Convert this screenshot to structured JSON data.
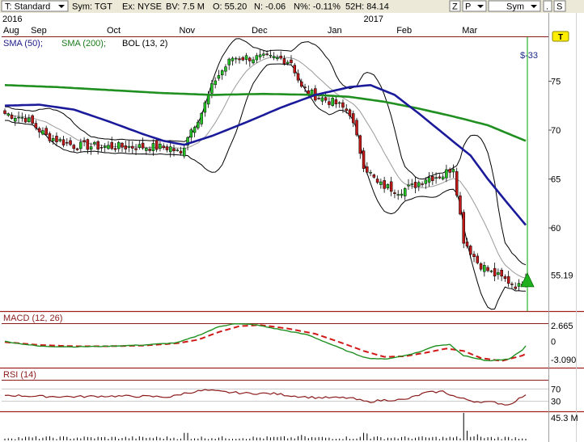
{
  "toolbar": {
    "template": "T: Standard",
    "symbol": "Sym: TGT",
    "exchange": "Ex: NYSE",
    "bid_volume": "BV: 7.5 M",
    "open": "O: 55.20",
    "net_change": "N: -0.06",
    "net_pct": "N%: -0.11%",
    "high52": "52H: 84.14",
    "btn_z": "Z",
    "btn_p": "P",
    "btn_sym": "Sym",
    "btn_dot": ".",
    "btn_s": "S"
  },
  "timeline": {
    "year_labels": [
      {
        "label": "2016",
        "index": 0
      },
      {
        "label": "2017",
        "index": 104
      }
    ],
    "month_labels": [
      {
        "label": "Aug",
        "index": 0
      },
      {
        "label": "Sep",
        "index": 8
      },
      {
        "label": "Oct",
        "index": 30
      },
      {
        "label": "Nov",
        "index": 51
      },
      {
        "label": "Dec",
        "index": 72
      },
      {
        "label": "Jan",
        "index": 94
      },
      {
        "label": "Feb",
        "index": 114
      },
      {
        "label": "Mar",
        "index": 133
      }
    ]
  },
  "chart_data": {
    "type": "candlestick",
    "symbol": "TGT",
    "bars": 152,
    "price_axis": {
      "ticks": [
        75,
        70,
        65,
        60
      ],
      "last_price": "55.19",
      "ylim": [
        51.5,
        79.5
      ]
    },
    "legend": {
      "sma50": "SMA (50);",
      "sma200": "SMA (200);",
      "bol": "BOL (13, 2)"
    },
    "signal": {
      "label": "$-33",
      "badge": "T"
    },
    "price_anchors": [
      [
        0,
        71.7
      ],
      [
        6,
        71.2
      ],
      [
        12,
        69.4
      ],
      [
        20,
        68.4
      ],
      [
        30,
        68.3
      ],
      [
        40,
        68.3
      ],
      [
        48,
        68.2
      ],
      [
        51,
        67.5
      ],
      [
        53,
        69.5
      ],
      [
        57,
        71.8
      ],
      [
        61,
        75.2
      ],
      [
        66,
        77.4
      ],
      [
        72,
        77.4
      ],
      [
        80,
        77.3
      ],
      [
        83,
        77.0
      ],
      [
        86,
        74.3
      ],
      [
        90,
        73.5
      ],
      [
        96,
        72.7
      ],
      [
        100,
        71.8
      ],
      [
        104,
        66.5
      ],
      [
        108,
        64.5
      ],
      [
        114,
        63.8
      ],
      [
        118,
        64.2
      ],
      [
        122,
        65.1
      ],
      [
        127,
        65.4
      ],
      [
        130,
        66.3
      ],
      [
        133,
        58.8
      ],
      [
        137,
        56.5
      ],
      [
        141,
        55.4
      ],
      [
        145,
        54.7
      ],
      [
        149,
        54.0
      ],
      [
        151,
        55.2
      ]
    ],
    "sma50_anchors": [
      [
        0,
        72.5
      ],
      [
        10,
        72.6
      ],
      [
        20,
        72.1
      ],
      [
        30,
        70.9
      ],
      [
        40,
        69.6
      ],
      [
        46,
        68.9
      ],
      [
        52,
        68.5
      ],
      [
        60,
        69.4
      ],
      [
        70,
        70.8
      ],
      [
        80,
        72.3
      ],
      [
        90,
        73.6
      ],
      [
        100,
        74.4
      ],
      [
        106,
        74.6
      ],
      [
        113,
        73.6
      ],
      [
        120,
        71.7
      ],
      [
        128,
        69.4
      ],
      [
        135,
        67.4
      ],
      [
        140,
        65.0
      ],
      [
        146,
        62.4
      ],
      [
        151,
        60.3
      ]
    ],
    "sma200_anchors": [
      [
        0,
        74.6
      ],
      [
        15,
        74.4
      ],
      [
        30,
        74.1
      ],
      [
        45,
        73.8
      ],
      [
        60,
        73.6
      ],
      [
        75,
        73.7
      ],
      [
        90,
        73.6
      ],
      [
        100,
        73.4
      ],
      [
        110,
        72.9
      ],
      [
        120,
        72.2
      ],
      [
        130,
        71.4
      ],
      [
        140,
        70.5
      ],
      [
        151,
        68.9
      ]
    ],
    "macd": {
      "label": "MACD (12, 26)",
      "ticks": [
        {
          "label": "2.665",
          "value": 2.665
        },
        {
          "label": "0",
          "value": 0
        },
        {
          "label": "-3.090",
          "value": -3.09
        }
      ],
      "ylim": [
        -4.3,
        3.1
      ],
      "macd_anchors": [
        [
          0,
          0
        ],
        [
          10,
          -0.8
        ],
        [
          20,
          -0.9
        ],
        [
          30,
          -0.8
        ],
        [
          40,
          -0.6
        ],
        [
          50,
          -0.2
        ],
        [
          56,
          1.0
        ],
        [
          62,
          2.5
        ],
        [
          66,
          3.0
        ],
        [
          72,
          2.9
        ],
        [
          80,
          2.0
        ],
        [
          88,
          1.1
        ],
        [
          95,
          -0.6
        ],
        [
          100,
          -1.8
        ],
        [
          105,
          -2.8
        ],
        [
          110,
          -3.0
        ],
        [
          115,
          -2.5
        ],
        [
          120,
          -1.8
        ],
        [
          125,
          -0.7
        ],
        [
          129,
          -0.5
        ],
        [
          133,
          -2.4
        ],
        [
          140,
          -3.3
        ],
        [
          146,
          -3.0
        ],
        [
          150,
          -1.5
        ],
        [
          151,
          -0.8
        ]
      ],
      "signal_anchors": [
        [
          0,
          -0.1
        ],
        [
          10,
          -0.6
        ],
        [
          20,
          -0.8
        ],
        [
          30,
          -0.8
        ],
        [
          40,
          -0.7
        ],
        [
          50,
          -0.3
        ],
        [
          56,
          0.3
        ],
        [
          62,
          1.6
        ],
        [
          68,
          2.6
        ],
        [
          74,
          2.8
        ],
        [
          82,
          2.2
        ],
        [
          90,
          1.3
        ],
        [
          98,
          -0.3
        ],
        [
          104,
          -1.6
        ],
        [
          110,
          -2.6
        ],
        [
          116,
          -2.5
        ],
        [
          122,
          -1.9
        ],
        [
          128,
          -1.2
        ],
        [
          133,
          -1.6
        ],
        [
          138,
          -2.8
        ],
        [
          144,
          -3.3
        ],
        [
          150,
          -2.4
        ],
        [
          151,
          -2.1
        ]
      ]
    },
    "rsi": {
      "label": "RSI (14)",
      "ticks": [
        {
          "label": "70",
          "value": 70
        },
        {
          "label": "30",
          "value": 30
        }
      ],
      "ylim": [
        0,
        100
      ],
      "anchors": [
        [
          0,
          50
        ],
        [
          10,
          46
        ],
        [
          20,
          45
        ],
        [
          30,
          47
        ],
        [
          40,
          46
        ],
        [
          48,
          44
        ],
        [
          52,
          56
        ],
        [
          58,
          66
        ],
        [
          64,
          60
        ],
        [
          70,
          56
        ],
        [
          78,
          55
        ],
        [
          84,
          47
        ],
        [
          90,
          42
        ],
        [
          100,
          41
        ],
        [
          105,
          28
        ],
        [
          110,
          34
        ],
        [
          116,
          35
        ],
        [
          122,
          58
        ],
        [
          127,
          62
        ],
        [
          131,
          43
        ],
        [
          136,
          30
        ],
        [
          142,
          26
        ],
        [
          146,
          18
        ],
        [
          150,
          45
        ],
        [
          151,
          48
        ]
      ]
    },
    "volume": {
      "label": "45.3 M",
      "max_m": 45.3
    }
  }
}
